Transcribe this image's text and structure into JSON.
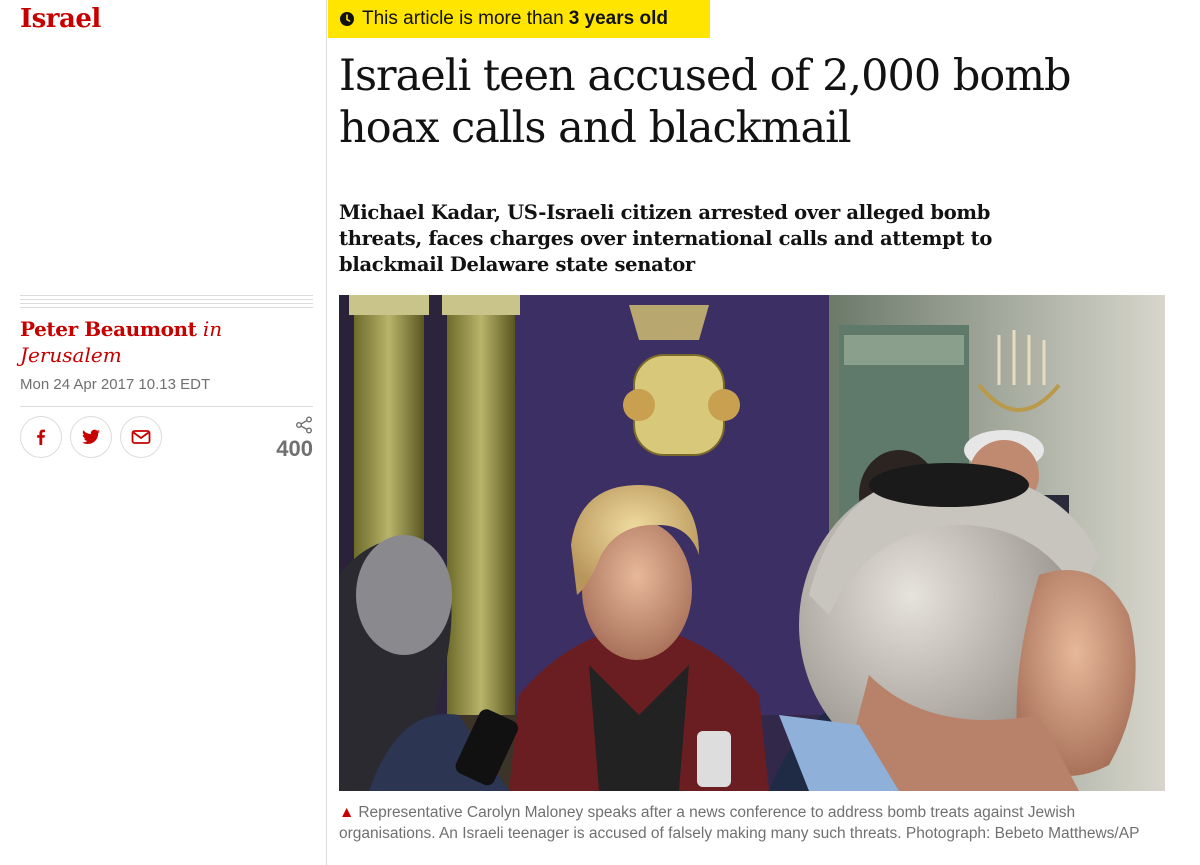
{
  "section": {
    "label": "Israel"
  },
  "age_banner": {
    "prefix": "This article is more than",
    "age": "3 years old"
  },
  "article": {
    "headline": "Israeli teen accused of 2,000 bomb hoax calls and blackmail",
    "standfirst": "Michael Kadar, US-Israeli citizen arrested over alleged bomb threats, faces charges over international calls and attempt to blackmail Delaware state senator"
  },
  "byline": {
    "author": "Peter Beaumont",
    "in_word": "in",
    "location": "Jerusalem",
    "date": "Mon 24 Apr 2017 10.13 EDT"
  },
  "share": {
    "count": "400",
    "icons": [
      "facebook-icon",
      "twitter-icon",
      "email-icon",
      "share-icon"
    ]
  },
  "caption": {
    "text": "Representative Carolyn Maloney speaks after a news conference to address bomb treats against Jewish organisations. An Israeli teenager is accused of falsely making many such threats. Photograph: Bebeto Matthews/AP"
  },
  "colors": {
    "accent": "#c70000",
    "banner": "#ffe500",
    "meta_text": "#707070"
  }
}
